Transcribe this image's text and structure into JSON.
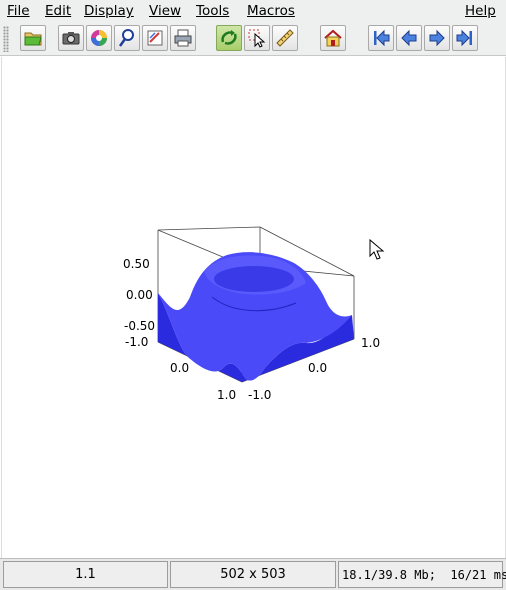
{
  "menu": {
    "file": "File",
    "edit": "Edit",
    "display": "Display",
    "view": "View",
    "tools": "Tools",
    "macros": "Macros",
    "help": "Help"
  },
  "toolbar": {
    "buttons": [
      {
        "icon": "open-folder-icon"
      },
      {
        "icon": "camera-icon"
      },
      {
        "icon": "color-wheel-icon"
      },
      {
        "icon": "magnifier-icon"
      },
      {
        "icon": "edit-icon"
      },
      {
        "icon": "print-icon"
      },
      {
        "icon": "rotate-icon",
        "active": true
      },
      {
        "icon": "select-pointer-icon"
      },
      {
        "icon": "ruler-icon"
      },
      {
        "icon": "home-icon"
      },
      {
        "icon": "first-arrow-icon"
      },
      {
        "icon": "prev-arrow-icon"
      },
      {
        "icon": "next-arrow-icon"
      },
      {
        "icon": "last-arrow-icon"
      }
    ]
  },
  "plot": {
    "z_ticks": [
      "0.50",
      "0.00",
      "-0.50"
    ],
    "x_ticks": [
      "-1.0",
      "0.0",
      "1.0"
    ],
    "y_ticks": [
      "-1.0",
      "0.0",
      "1.0"
    ],
    "surface_color": "#3f3ff5"
  },
  "status": {
    "zoom": "1.1",
    "size": "502 x 503",
    "memory": "18.1/39.8 Mb;  16/21 ms"
  }
}
